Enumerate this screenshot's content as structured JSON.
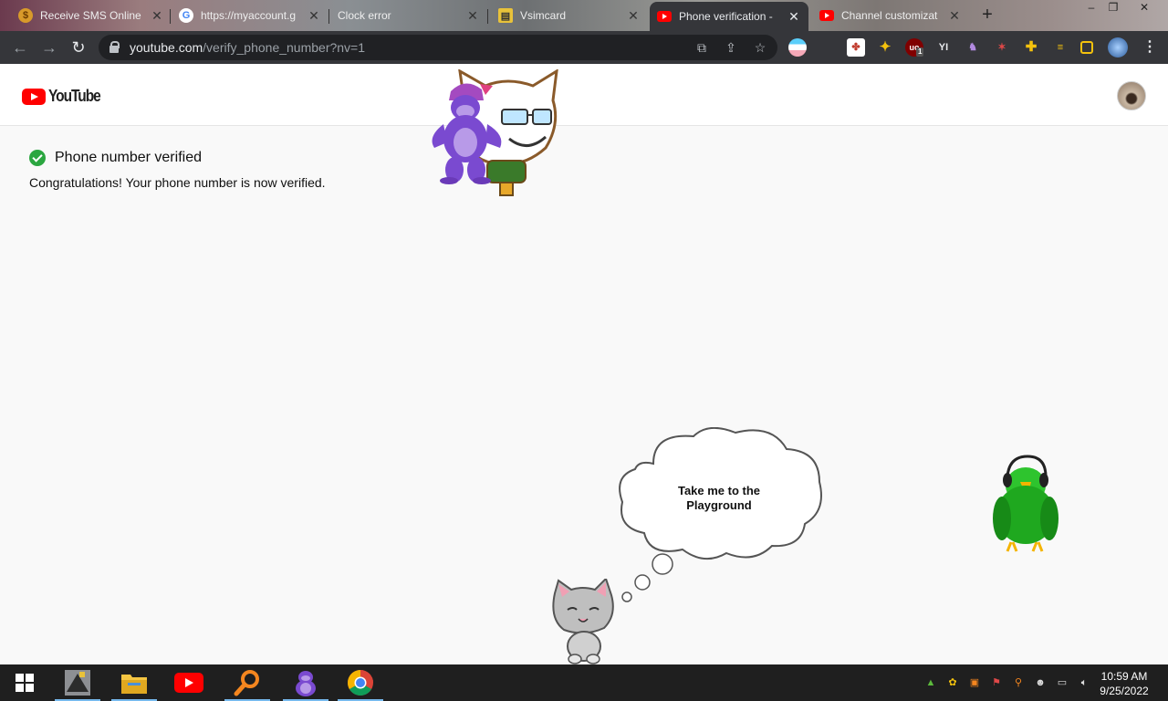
{
  "browser": {
    "tabs": [
      {
        "title": "Receive SMS Online",
        "favicon": "coin-icon",
        "active": false
      },
      {
        "title": "https://myaccount.g",
        "favicon": "google-icon",
        "active": false
      },
      {
        "title": "Clock error",
        "favicon": "none",
        "active": false
      },
      {
        "title": "Vsimcard",
        "favicon": "sim-icon",
        "active": false
      },
      {
        "title": "Phone verification -",
        "favicon": "youtube-icon",
        "active": true
      },
      {
        "title": "Channel customizat",
        "favicon": "youtube-icon",
        "active": false
      }
    ],
    "new_tab_label": "+",
    "url_host": "youtube.com",
    "url_path": "/verify_phone_number?nv=1",
    "ext_badge": "1"
  },
  "youtube": {
    "logo_text": "YouTube",
    "verified_title": "Phone number verified",
    "verified_message": "Congratulations! Your phone number is now verified."
  },
  "overlay": {
    "thought_bubble_text": "Take me to the Playground"
  },
  "taskbar": {
    "apps": [
      "app-icon",
      "file-explorer-icon",
      "youtube-icon",
      "search-icon",
      "bonzi-icon",
      "chrome-icon"
    ],
    "time": "10:59 AM",
    "date": "9/25/2022"
  },
  "colors": {
    "brand_red": "#ff0000",
    "check_green": "#2ba640",
    "browser_dark": "#35363a"
  }
}
